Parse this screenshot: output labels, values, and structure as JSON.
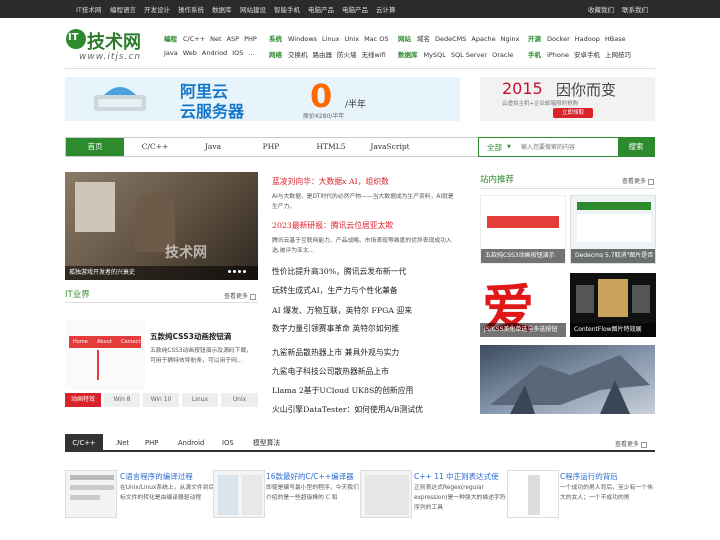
{
  "topbar": {
    "links": [
      "IT技术网",
      "编程语言",
      "开发设计",
      "操作系统",
      "数据库",
      "网站建设",
      "智能手机",
      "电脑产品",
      "电脑产品",
      "云计算"
    ],
    "right": [
      "收藏我们",
      "联系我们"
    ]
  },
  "logo": {
    "name": "技术网",
    "number": "IT",
    "url": "www.itjs.cn"
  },
  "categories": [
    {
      "name": "编程",
      "items": [
        "C/C++",
        "Net",
        "ASP",
        "PHP"
      ]
    },
    {
      "name": "",
      "items": [
        "Java",
        "Web",
        "Andriod",
        "IOS",
        "..."
      ]
    },
    {
      "name": "系统",
      "items": [
        "Windows",
        "Linux",
        "Unix",
        "Mac OS"
      ]
    },
    {
      "name": "网络",
      "items": [
        "交换机",
        "路由器",
        "防火墙",
        "无线wifi"
      ]
    },
    {
      "name": "网站",
      "items": [
        "域名",
        "DedeCMS",
        "Apache",
        "Nginx"
      ]
    },
    {
      "name": "数据库",
      "items": [
        "MySQL",
        "SQL Server",
        "Oracle"
      ]
    },
    {
      "name": "开源",
      "items": [
        "Docker",
        "Hadoop",
        "HBase"
      ]
    },
    {
      "name": "手机",
      "items": [
        "iPhone",
        "安卓手机",
        "上网技巧"
      ]
    }
  ],
  "banner1": {
    "title_line1": "阿里云",
    "title_line2": "云服务器",
    "price": "0",
    "unit": "/半年",
    "sub": "原价¥280/半年",
    "colors": {
      "bg": "#e7f4fc",
      "text": "#1677c8",
      "price": "#ff6a00"
    }
  },
  "banner2": {
    "year": "2015",
    "headline": "因你而变",
    "sub": "云虚拟主机+企业邮箱限时抢购",
    "button": "立即领取"
  },
  "nav": {
    "tabs": [
      "首页",
      "C/C++",
      "Java",
      "PHP",
      "HTML5",
      "JavaScript"
    ],
    "active": 0
  },
  "search": {
    "option": "全部",
    "placeholder": "输入您要搜索的内容",
    "button": "搜索"
  },
  "feature": {
    "caption": "孤独游戏开发者的兴衰史",
    "watermark": "技术网"
  },
  "main_news": [
    {
      "title": "蓝凌刘向华：大数据x AI，组织数",
      "summary": "AI与大数据，是DT时代的必然产物——当大数据成为生产资料，AI就是生产力。",
      "red": true
    },
    {
      "title": "2023最新研报：腾讯云位居亚太欺",
      "summary": "腾讯云基于互联网能力、产品战略、市场表现等维度的优异表现成功入选,被评为亚太...",
      "red": true
    },
    {
      "title": "性价比提升高30%，腾讯云发布新一代",
      "red": false
    },
    {
      "title": "玩转生成式AI，生产力与个性化兼备",
      "red": false
    },
    {
      "title": "AI 爆发、万物互联，英特尔 FPGA 迎来",
      "red": false
    },
    {
      "title": "数字力量引领赛事革命 英特尔如何推",
      "red": false
    }
  ],
  "more_news": [
    "九鲨新品散热器上市 兼具外观与实力",
    "九鲨电子科技公司散热器新品上市",
    "Llama 2基于UCloud UK8S的创新应用",
    "火山引擎DataTester：如何使用A/B测试优"
  ],
  "it_world": {
    "header": "IT业界",
    "more": "查看更多",
    "article_title": "五款纯CSS3动画按钮滴",
    "article_summary": "五款纯CSS3动画按钮演示及源码下载，可用于摘特效导航条，可以用于网...",
    "tags": [
      "动画特效",
      "Win 8",
      "Win 10",
      "Linux",
      "Unix"
    ],
    "demo_menu": [
      "Home",
      "About",
      "Contact"
    ]
  },
  "sidebar": {
    "header": "站内推荐",
    "more": "查看更多",
    "items": [
      "五款纯CSS3动画按钮演示",
      "Dedecms 5.7取消\"图片是否",
      "JS/CSS美化单选与多选按钮",
      "ContentFlow图片特效展"
    ]
  },
  "bottom": {
    "tabs": [
      "C/C++",
      ".Net",
      "PHP",
      "Android",
      "IOS",
      "模型算法"
    ],
    "active": 0,
    "more": "查看更多",
    "items": [
      {
        "title": "C语言程序的编译过程",
        "summary": "在Unix/Linux系统上，从源文件到目标文件的转化是由编译器驱动程"
      },
      {
        "title": "16款最好的C/C++编译器",
        "summary": "即使是编写最小型的程序，今天我们介绍的是一些超级棒的 C 和"
      },
      {
        "title": "C++ 11 中正则表达式使",
        "summary": "正则表达式Regex(regular expression)是一种强大的描述字符序列的工具"
      },
      {
        "title": "C程序运行的背后",
        "summary": "一个成功的男人背后，至少有一个伟大的女人；一个不成功的男"
      }
    ]
  },
  "colors": {
    "green": "#2d8a2d",
    "red": "#d9222a",
    "dark": "#2b2b2b"
  }
}
